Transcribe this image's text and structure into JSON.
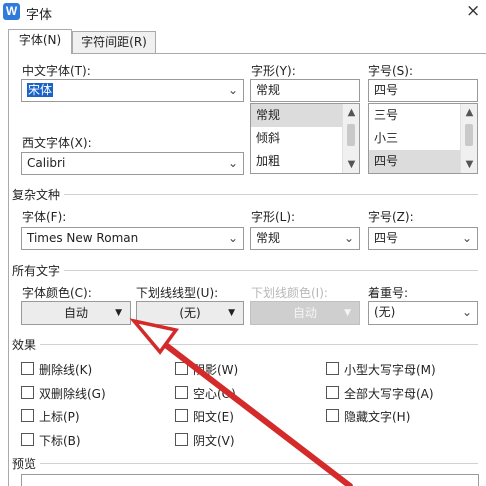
{
  "window": {
    "title": "字体",
    "app_icon": "W",
    "close_glyph": "×"
  },
  "tabs": [
    {
      "label": "字体(N)"
    },
    {
      "label": "字符间距(R)"
    }
  ],
  "chinese_font": {
    "label": "中文字体(T):",
    "value": "宋体"
  },
  "western_font": {
    "label": "西文字体(X):",
    "value": "Calibri"
  },
  "style": {
    "label": "字形(Y):",
    "value": "常规",
    "options": [
      "常规",
      "倾斜",
      "加粗"
    ],
    "selected": "常规"
  },
  "size": {
    "label": "字号(S):",
    "value": "四号",
    "options": [
      "三号",
      "小三",
      "四号"
    ],
    "selected": "四号"
  },
  "complex": {
    "title": "复杂文种",
    "font_label": "字体(F):",
    "font_value": "Times New Roman",
    "style_label": "字形(L):",
    "style_value": "常规",
    "size_label": "字号(Z):",
    "size_value": "四号"
  },
  "all_text": {
    "title": "所有文字",
    "color_label": "字体颜色(C):",
    "color_value": "自动",
    "underline_label": "下划线线型(U):",
    "underline_value": "(无)",
    "underline_color_label": "下划线颜色(I):",
    "underline_color_value": "自动",
    "emphasis_label": "着重号:",
    "emphasis_value": "(无)"
  },
  "effects": {
    "title": "效果",
    "items": [
      {
        "label": "删除线(K)"
      },
      {
        "label": "阴影(W)"
      },
      {
        "label": "小型大写字母(M)"
      },
      {
        "label": "双删除线(G)"
      },
      {
        "label": "空心(O)"
      },
      {
        "label": "全部大写字母(A)"
      },
      {
        "label": "上标(P)"
      },
      {
        "label": "阳文(E)"
      },
      {
        "label": "隐藏文字(H)"
      },
      {
        "label": "下标(B)"
      },
      {
        "label": "阴文(V)"
      }
    ]
  },
  "preview": {
    "title": "预览"
  },
  "icons": {
    "dropdown": "chevron-down-icon",
    "arrow": "red-arrow-annotation"
  },
  "colors": {
    "accent": "#1b63c6",
    "annotation": "#d42a2a"
  }
}
